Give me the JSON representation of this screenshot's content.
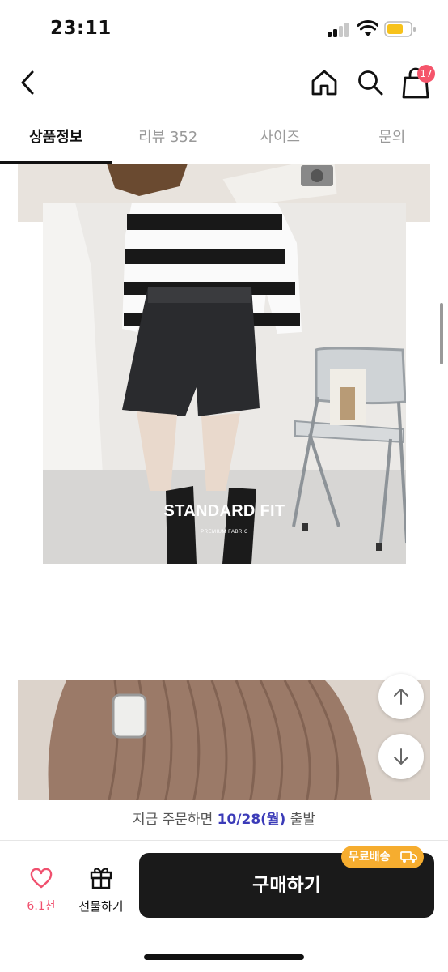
{
  "status_bar": {
    "time": "23:11"
  },
  "header": {
    "cart_count": "17"
  },
  "tabs": [
    {
      "label": "상품정보"
    },
    {
      "label": "리뷰 352"
    },
    {
      "label": "사이즈"
    },
    {
      "label": "문의"
    }
  ],
  "product_image": {
    "title": "STANDARD FIT",
    "subtitle": "PREMIUM FABRIC"
  },
  "shipping": {
    "prefix": "지금 주문하면",
    "date": "10/28(월)",
    "suffix": "출발"
  },
  "bottom": {
    "like_count": "6.1천",
    "gift_label": "선물하기",
    "buy_label": "구매하기",
    "free_shipping": "무료배송"
  },
  "colors": {
    "accent_pink": "#f0506e",
    "free_shipping_bg": "#f6ad2f",
    "shipping_date": "#3b3bb8",
    "buy_button_bg": "#1a1a1a"
  }
}
